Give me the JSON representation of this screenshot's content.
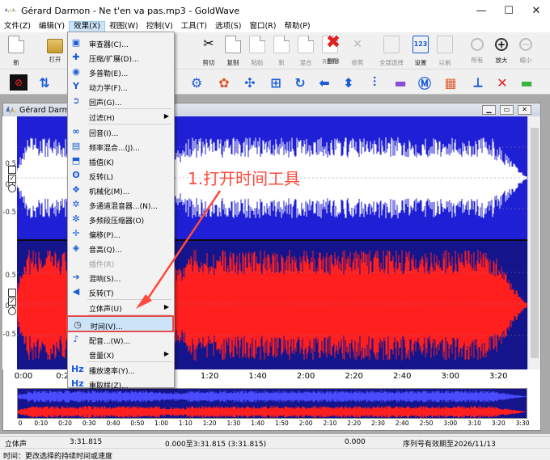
{
  "window": {
    "title": "Gérard Darmon - Ne t'en va pas.mp3 - GoldWave",
    "doc_title": "Gérard Darm",
    "controls": [
      "—",
      "☐",
      "✕"
    ]
  },
  "menubar": [
    "文件(Z)",
    "编辑(Y)",
    "效果(X)",
    "视图(W)",
    "控制(V)",
    "工具(T)",
    "选项(S)",
    "窗口(R)",
    "帮助(P)"
  ],
  "toolbar": [
    {
      "label": "新",
      "icon": "new-file-icon",
      "dim": false
    },
    {
      "label": "打开",
      "icon": "open-folder-icon",
      "dim": false
    },
    {
      "label": "剪切",
      "icon": "scissors-icon",
      "dim": false
    },
    {
      "label": "复制",
      "icon": "copy-icon",
      "dim": false
    },
    {
      "label": "粘贴",
      "icon": "paste-icon",
      "dim": true
    },
    {
      "label": "新",
      "icon": "paste-new-icon",
      "dim": true
    },
    {
      "label": "混合",
      "icon": "mix-icon",
      "dim": true
    },
    {
      "label": "REPL",
      "icon": "replace-icon",
      "dim": true
    },
    {
      "label": "删除",
      "icon": "delete-icon",
      "dim": false
    },
    {
      "label": "修剪",
      "icon": "trim-icon",
      "dim": true
    },
    {
      "label": "全部选择",
      "icon": "select-all-icon",
      "dim": true
    },
    {
      "label": "设置",
      "icon": "set-marker-icon",
      "dim": false
    },
    {
      "label": "以前",
      "icon": "previous-icon",
      "dim": true
    },
    {
      "label": "所有",
      "icon": "zoom-all-icon",
      "dim": true
    },
    {
      "label": "放大",
      "icon": "zoom-in-icon",
      "dim": false
    },
    {
      "label": "缩小",
      "icon": "zoom-out-icon",
      "dim": true
    }
  ],
  "effects_menu": [
    {
      "label": "审查器(C)...",
      "icon": "inspector-icon",
      "dim": false,
      "sub": false
    },
    {
      "label": "压缩/扩展(D)...",
      "icon": "compress-icon",
      "dim": false,
      "sub": false
    },
    {
      "label": "多普勒(E)...",
      "icon": "doppler-icon",
      "dim": false,
      "sub": false
    },
    {
      "label": "动力学(F)...",
      "icon": "dynamics-icon",
      "dim": false,
      "sub": false
    },
    {
      "label": "回声(G)...",
      "icon": "echo-icon",
      "dim": false,
      "sub": false
    },
    {
      "label": "过滤(H)",
      "icon": "filter-icon",
      "dim": false,
      "sub": true
    },
    {
      "label": "回音(I)...",
      "icon": "reverb-icon",
      "dim": false,
      "sub": false
    },
    {
      "label": "频率混合...(J)...",
      "icon": "freq-mix-icon",
      "dim": false,
      "sub": false
    },
    {
      "label": "插值(K)",
      "icon": "interpolate-icon",
      "dim": false,
      "sub": false
    },
    {
      "label": "反转(L)",
      "icon": "invert-icon",
      "dim": false,
      "sub": false
    },
    {
      "label": "机械化(M)...",
      "icon": "mechanize-icon",
      "dim": false,
      "sub": false
    },
    {
      "label": "多通道混音器...(N)...",
      "icon": "channel-mixer-icon",
      "dim": false,
      "sub": false
    },
    {
      "label": "多频段压缩器(O)",
      "icon": "multiband-icon",
      "dim": false,
      "sub": false
    },
    {
      "label": "偏移(P)...",
      "icon": "offset-icon",
      "dim": false,
      "sub": false
    },
    {
      "label": "音高(Q)...",
      "icon": "pitch-icon",
      "dim": false,
      "sub": false
    },
    {
      "label": "插件(R)",
      "icon": "plugin-icon",
      "dim": true,
      "sub": false
    },
    {
      "label": "混响(S)...",
      "icon": "reverb2-icon",
      "dim": false,
      "sub": false
    },
    {
      "label": "反转(T)",
      "icon": "reverse-icon",
      "dim": false,
      "sub": false
    },
    {
      "label": "立体声(U)",
      "icon": "stereo-icon",
      "dim": false,
      "sub": true
    },
    {
      "label": "时间(V)...",
      "icon": "clock-icon",
      "dim": false,
      "sub": false
    },
    {
      "label": "配音...(W)...",
      "icon": "voice-icon",
      "dim": false,
      "sub": false
    },
    {
      "label": "音量(X)",
      "icon": "volume-icon",
      "dim": false,
      "sub": true
    },
    {
      "label": "播放速率(Y)...",
      "icon": "playback-rate-icon",
      "dim": false,
      "sub": false
    },
    {
      "label": "重取样(Z)...",
      "icon": "resample-icon",
      "dim": false,
      "sub": false
    }
  ],
  "annotation": "1.打开时间工具",
  "y_ticks": [
    "0.5",
    "0.0",
    "-0.5",
    "0.5",
    "0.0",
    "-0.5"
  ],
  "time_ticks": [
    "0:00",
    "0:20",
    "0:40",
    "1:00",
    "1:20",
    "1:40",
    "2:00",
    "2:20",
    "2:40",
    "3:00",
    "3:20"
  ],
  "mini_ticks": [
    "0",
    "0:10",
    "0:20",
    "0:30",
    "0:40",
    "0:50",
    "1:00",
    "1:10",
    "1:20",
    "1:30",
    "1:40",
    "1:50",
    "2:00",
    "2:10",
    "2:20",
    "2:30",
    "2:40",
    "2:50",
    "3:00",
    "3:10",
    "3:20",
    "3:30"
  ],
  "status": {
    "channel": "立体声",
    "duration": "3:31.815",
    "selection": "0.000至3:31.815 (3:31.815)",
    "position": "0.000",
    "license": "序列号有效期至2026/11/13",
    "help": "时间：更改选择的持续时间或速度"
  },
  "colors": {
    "left_channel": "#1f1fd6",
    "left_peak": "#ffffff",
    "right_channel": "#ff1f1f",
    "right_bg": "#14148c",
    "annotation": "#ff4a3d",
    "highlight_border": "#e84b4b"
  }
}
